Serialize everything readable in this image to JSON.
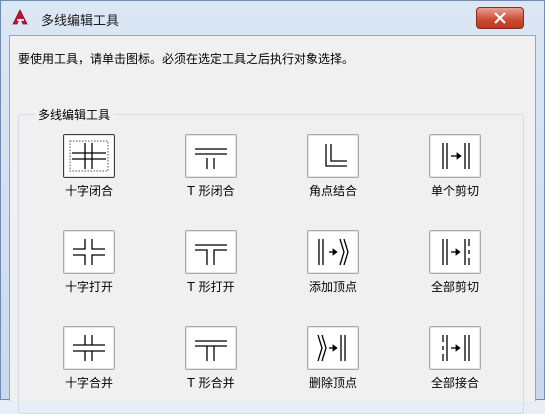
{
  "window": {
    "title": "多线编辑工具",
    "app_icon": "autocad-a-icon",
    "close_icon": "close-icon"
  },
  "instruction": "要使用工具，请单击图标。必须在选定工具之后执行对象选择。",
  "group": {
    "label": "多线编辑工具",
    "tools": [
      {
        "label": "十字闭合",
        "icon": "cross-closed-icon"
      },
      {
        "label": "T 形闭合",
        "icon": "tee-closed-icon"
      },
      {
        "label": "角点结合",
        "icon": "corner-joint-icon"
      },
      {
        "label": "单个剪切",
        "icon": "cut-single-icon"
      },
      {
        "label": "十字打开",
        "icon": "cross-open-icon"
      },
      {
        "label": "T 形打开",
        "icon": "tee-open-icon"
      },
      {
        "label": "添加顶点",
        "icon": "add-vertex-icon"
      },
      {
        "label": "全部剪切",
        "icon": "cut-all-icon"
      },
      {
        "label": "十字合并",
        "icon": "cross-merged-icon"
      },
      {
        "label": "T 形合并",
        "icon": "tee-merged-icon"
      },
      {
        "label": "删除顶点",
        "icon": "delete-vertex-icon"
      },
      {
        "label": "全部接合",
        "icon": "weld-all-icon"
      }
    ]
  },
  "colors": {
    "title_bar": "#c9d9ee",
    "close_button": "#c84a32",
    "client_bg": "#f0f0f0"
  }
}
